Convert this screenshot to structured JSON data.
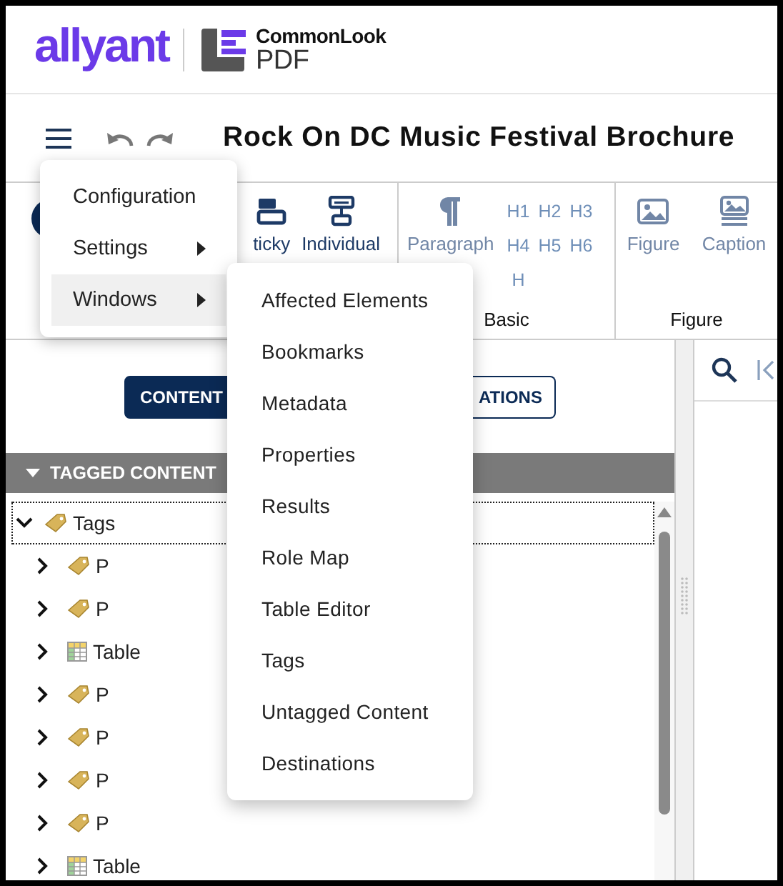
{
  "logo": {
    "brand": "allyant",
    "product": "CommonLook",
    "product_sub": "PDF"
  },
  "title_bar": {
    "title": "Rock On DC Music Festival Brochure"
  },
  "toolbar": {
    "groups": [
      {
        "tools": [
          {
            "kind": "sticky",
            "label": "ticky",
            "disabled": false
          },
          {
            "kind": "individual",
            "label": "Individual",
            "disabled": false
          }
        ]
      },
      {
        "label": "Basic",
        "tools": [
          {
            "kind": "paragraph",
            "label": "Paragraph",
            "disabled": true
          }
        ],
        "headings": [
          "H1",
          "H2",
          "H3",
          "H4",
          "H5",
          "H6",
          "H"
        ]
      },
      {
        "label": "Figure",
        "tools": [
          {
            "kind": "figure",
            "label": "Figure",
            "disabled": true
          },
          {
            "kind": "caption",
            "label": "Caption",
            "disabled": true
          }
        ]
      }
    ]
  },
  "view_switch": [
    {
      "label": "CONTENT",
      "selected": true
    },
    {
      "label": "ATIONS",
      "selected": false
    }
  ],
  "panel": {
    "header": "TAGGED CONTENT",
    "expanded": true
  },
  "tree": {
    "label": "Tags",
    "kind": "tag",
    "expanded": true,
    "focused": true,
    "children": [
      {
        "label": "P",
        "kind": "tag",
        "expanded": false
      },
      {
        "label": "P",
        "kind": "tag",
        "expanded": false
      },
      {
        "label": "Table",
        "kind": "table",
        "expanded": false
      },
      {
        "label": "P",
        "kind": "tag",
        "expanded": false
      },
      {
        "label": "P",
        "kind": "tag",
        "expanded": false
      },
      {
        "label": "P",
        "kind": "tag",
        "expanded": false
      },
      {
        "label": "P",
        "kind": "tag",
        "expanded": false
      },
      {
        "label": "Table",
        "kind": "table",
        "expanded": false
      }
    ]
  },
  "menu": {
    "items": [
      {
        "label": "Configuration",
        "submenu": false,
        "highlighted": false
      },
      {
        "label": "Settings",
        "submenu": true,
        "highlighted": false
      },
      {
        "label": "Windows",
        "submenu": true,
        "highlighted": true
      }
    ]
  },
  "submenu": {
    "items": [
      "Affected Elements",
      "Bookmarks",
      "Metadata",
      "Properties",
      "Results",
      "Role Map",
      "Table Editor",
      "Tags",
      "Untagged Content",
      "Destinations"
    ]
  }
}
